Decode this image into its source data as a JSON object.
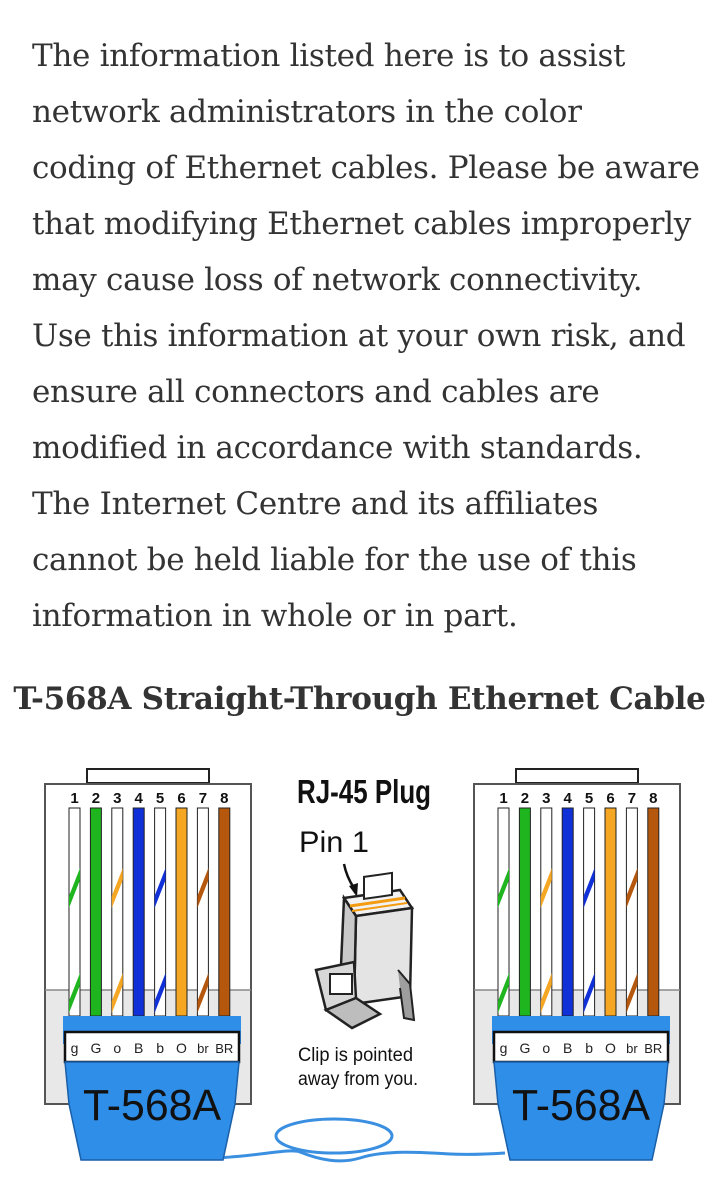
{
  "intro": {
    "lines": [
      "The information listed here is to assist",
      "network administrators in the color",
      "coding of Ethernet cables. Please be aware",
      "that modifying Ethernet cables improperly",
      "may cause loss of network connectivity.",
      "Use this information at your own risk, and",
      "ensure all connectors and cables are",
      "modified in accordance with standards.",
      "The Internet Centre and its affiliates",
      "cannot be held liable for the use of this",
      "information in whole or in part."
    ]
  },
  "heading": "T-568A Straight-Through Ethernet Cable",
  "diagram": {
    "plug_title": "RJ-45 Plug",
    "pin_label": "Pin 1",
    "clip_note_line1": "Clip is pointed",
    "clip_note_line2": "away from you.",
    "left_connector": {
      "label": "T-568A",
      "pin_numbers": [
        "1",
        "2",
        "3",
        "4",
        "5",
        "6",
        "7",
        "8"
      ],
      "wire_codes": [
        "g",
        "G",
        "o",
        "B",
        "b",
        "O",
        "br",
        "BR"
      ]
    },
    "right_connector": {
      "label": "T-568A",
      "pin_numbers": [
        "1",
        "2",
        "3",
        "4",
        "5",
        "6",
        "7",
        "8"
      ],
      "wire_codes": [
        "g",
        "G",
        "o",
        "B",
        "b",
        "O",
        "br",
        "BR"
      ]
    },
    "colors": {
      "green": "#1fb51f",
      "orange": "#f5a623",
      "blue": "#1030d8",
      "brown": "#b5580e",
      "connector_blue": "#2f8ee8",
      "cable_blue": "#3a8fe0",
      "text": "#333333"
    }
  }
}
